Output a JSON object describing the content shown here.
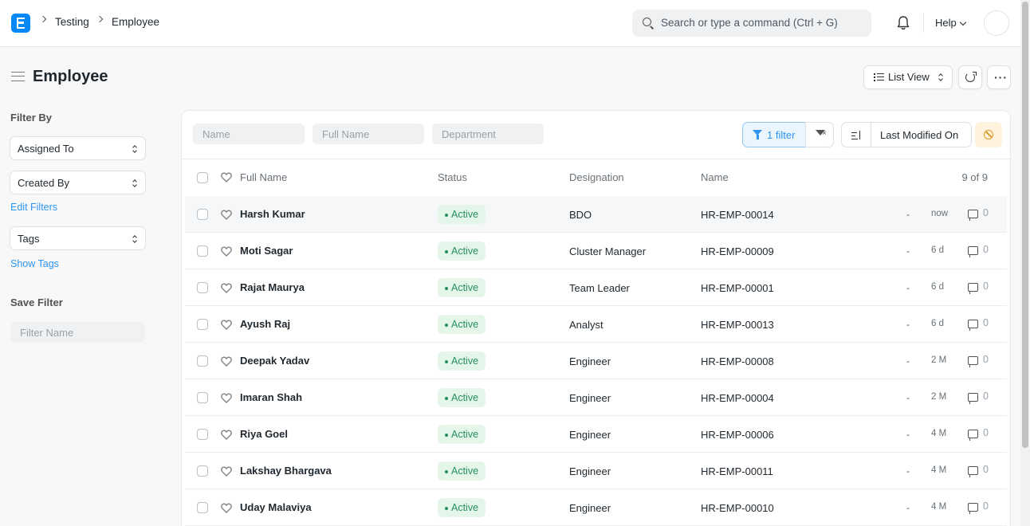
{
  "navbar": {
    "breadcrumbs": [
      "Testing",
      "Employee"
    ],
    "search_placeholder": "Search or type a command (Ctrl + G)",
    "help_label": "Help"
  },
  "page": {
    "title": "Employee",
    "view_label": "List View"
  },
  "sidebar": {
    "filter_by_label": "Filter By",
    "assigned_to_label": "Assigned To",
    "created_by_label": "Created By",
    "edit_filters_label": "Edit Filters",
    "tags_label": "Tags",
    "show_tags_label": "Show Tags",
    "save_filter_label": "Save Filter",
    "filter_name_placeholder": "Filter Name"
  },
  "filters": {
    "name_placeholder": "Name",
    "full_name_placeholder": "Full Name",
    "department_placeholder": "Department",
    "filter_button_label": "1 filter",
    "sort_by_label": "Last Modified On"
  },
  "table": {
    "columns": [
      "Full Name",
      "Status",
      "Designation",
      "Name"
    ],
    "count_label": "9 of 9",
    "rows": [
      {
        "full_name": "Harsh Kumar",
        "status": "Active",
        "designation": "BDO",
        "name": "HR-EMP-00014",
        "dash": "-",
        "modified": "now",
        "comments": "0"
      },
      {
        "full_name": "Moti Sagar",
        "status": "Active",
        "designation": "Cluster Manager",
        "name": "HR-EMP-00009",
        "dash": "-",
        "modified": "6 d",
        "comments": "0"
      },
      {
        "full_name": "Rajat Maurya",
        "status": "Active",
        "designation": "Team Leader",
        "name": "HR-EMP-00001",
        "dash": "-",
        "modified": "6 d",
        "comments": "0"
      },
      {
        "full_name": "Ayush Raj",
        "status": "Active",
        "designation": "Analyst",
        "name": "HR-EMP-00013",
        "dash": "-",
        "modified": "6 d",
        "comments": "0"
      },
      {
        "full_name": "Deepak Yadav",
        "status": "Active",
        "designation": "Engineer",
        "name": "HR-EMP-00008",
        "dash": "-",
        "modified": "2 M",
        "comments": "0"
      },
      {
        "full_name": "Imaran Shah",
        "status": "Active",
        "designation": "Engineer",
        "name": "HR-EMP-00004",
        "dash": "-",
        "modified": "2 M",
        "comments": "0"
      },
      {
        "full_name": "Riya Goel",
        "status": "Active",
        "designation": "Engineer",
        "name": "HR-EMP-00006",
        "dash": "-",
        "modified": "4 M",
        "comments": "0"
      },
      {
        "full_name": "Lakshay Bhargava",
        "status": "Active",
        "designation": "Engineer",
        "name": "HR-EMP-00011",
        "dash": "-",
        "modified": "4 M",
        "comments": "0"
      },
      {
        "full_name": "Uday Malaviya",
        "status": "Active",
        "designation": "Engineer",
        "name": "HR-EMP-00010",
        "dash": "-",
        "modified": "4 M",
        "comments": "0"
      }
    ]
  },
  "colors": {
    "accent": "#2d95f0",
    "brand": "#0289f7",
    "status_active_bg": "#e4f5e9",
    "status_active_text": "#278f5e"
  },
  "icons": [
    "app-logo-icon",
    "chevron-right-icon",
    "search-icon",
    "bell-icon",
    "chevron-down-icon",
    "hamburger-icon",
    "list-icon",
    "refresh-icon",
    "more-icon",
    "filter-icon",
    "filter-clear-icon",
    "sort-icon",
    "ban-icon",
    "heart-icon",
    "comment-icon"
  ]
}
